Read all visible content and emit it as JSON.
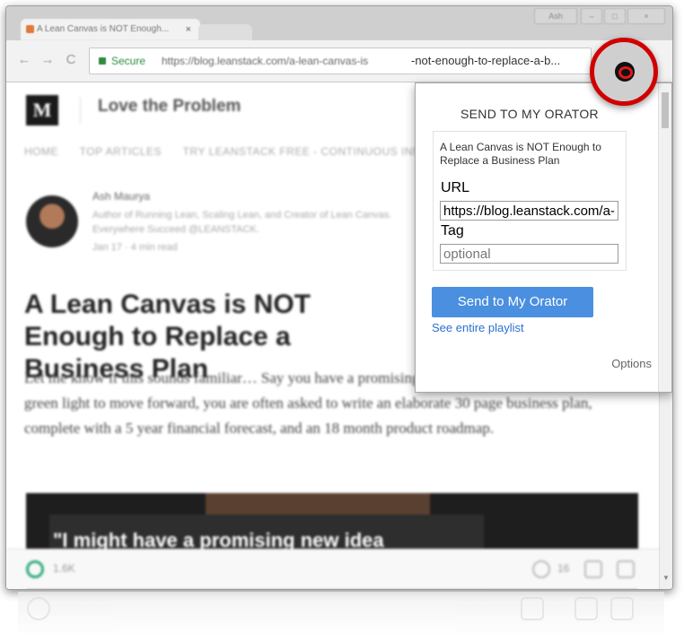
{
  "browser": {
    "tab_title": "A Lean Canvas is NOT Enough...",
    "tab_close": "×",
    "window_user": "Ash",
    "back": "←",
    "forward": "→",
    "reload": "C",
    "secure_label": "Secure",
    "url_blurred": "https://blog.leanstack.com/a-lean-canvas-is",
    "url_visible": "-not-enough-to-replace-a-b..."
  },
  "page": {
    "logo": "M",
    "publication": "Love the Problem",
    "nav": [
      "HOME",
      "TOP ARTICLES",
      "TRY LEANSTACK FREE - CONTINUOUS INNOVATION"
    ],
    "author": "Ash Maurya",
    "author_bio": "Author of Running Lean, Scaling Lean, and Creator of Lean Canvas. Everywhere Succeed @LEANSTACK.",
    "author_meta": "Jan 17 · 4 min read",
    "headline": "A Lean Canvas is NOT Enough to Replace a Business Plan",
    "body": "Let me know if this sounds familiar… Say you have a promising new idea and you want the green light to move forward, you are often asked to write an elaborate 30 page business plan, complete with a 5 year financial forecast, and an 18 month product roadmap.",
    "hero_quote": "\"I might have a promising new idea",
    "claps": "1.6K",
    "responses": "16"
  },
  "popup": {
    "title": "SEND TO MY ORATOR",
    "article_title": "A Lean Canvas is NOT Enough to Replace a Business Plan",
    "url_label": "URL",
    "url_value": "https://blog.leanstack.com/a-lean-canvas-is-not-enough-to-replace-a-business-plan",
    "tag_label": "Tag",
    "tag_placeholder": "optional",
    "send_button": "Send to My Orator",
    "playlist_link": "See entire playlist",
    "options_link": "Options"
  },
  "colors": {
    "send_button": "#4a8fe0",
    "link": "#2a6fd0",
    "highlight_circle": "#d10000",
    "extension_icon": "#e01818"
  }
}
